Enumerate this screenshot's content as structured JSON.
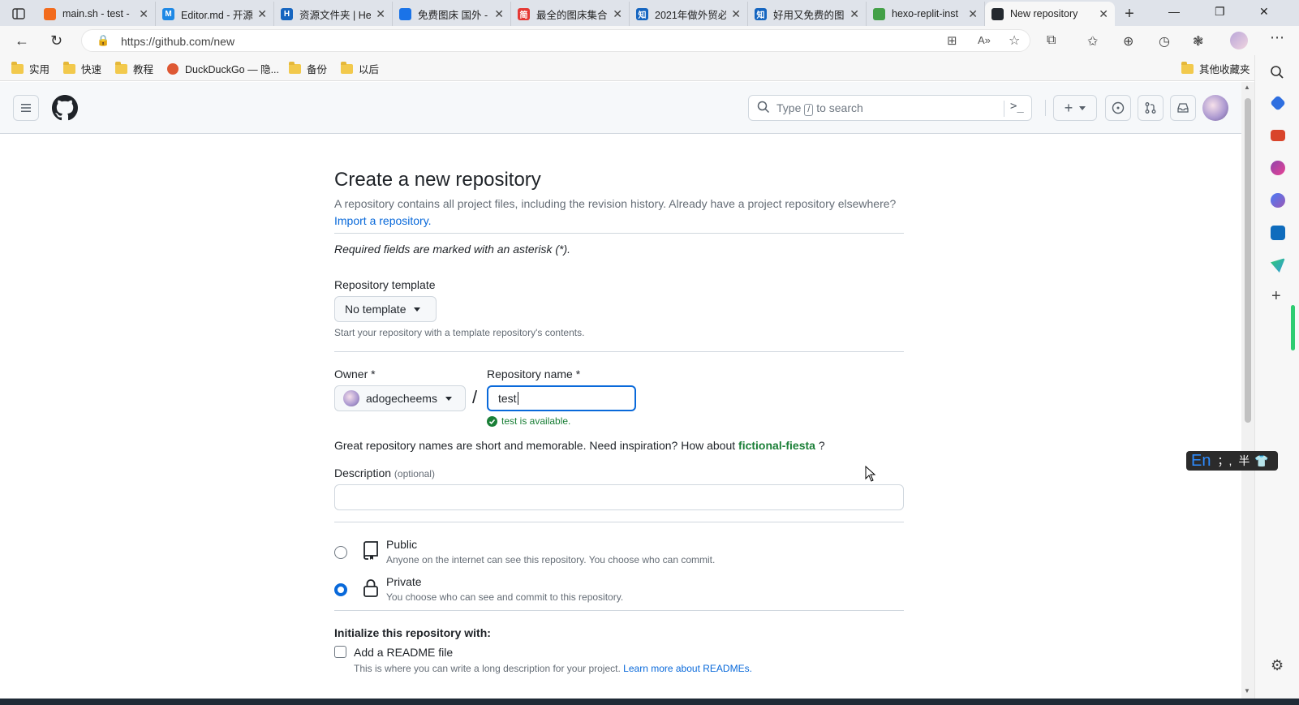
{
  "browser": {
    "tabs": [
      {
        "title": "main.sh - test -",
        "color": "#f26b1d",
        "glyph": ""
      },
      {
        "title": "Editor.md - 开源",
        "color": "#1e88e5",
        "glyph": "M"
      },
      {
        "title": "资源文件夹 | He",
        "color": "#1565c0",
        "glyph": "H"
      },
      {
        "title": "免费图床 国外 -",
        "color": "#1a73e8",
        "glyph": ""
      },
      {
        "title": "最全的图床集合",
        "color": "#e53935",
        "glyph": "简"
      },
      {
        "title": "2021年做外贸必",
        "color": "#1565c0",
        "glyph": "知"
      },
      {
        "title": "好用又免费的图",
        "color": "#1565c0",
        "glyph": "知"
      },
      {
        "title": "hexo-replit-inst",
        "color": "#43a047",
        "glyph": ""
      },
      {
        "title": "New repository",
        "color": "#24292f",
        "glyph": ""
      }
    ],
    "url": "https://github.com/new",
    "bookmarks": [
      "实用",
      "快速",
      "教程",
      "DuckDuckGo — 隐...",
      "备份",
      "以后"
    ],
    "other_bookmarks": "其他收藏夹"
  },
  "github": {
    "search_placeholder_prefix": "Type",
    "search_key": "/",
    "search_placeholder_suffix": "to search"
  },
  "form": {
    "title": "Create a new repository",
    "subtitle": "A repository contains all project files, including the revision history. Already have a project repository elsewhere?",
    "import_link": "Import a repository.",
    "required_note": "Required fields are marked with an asterisk (*).",
    "template_label": "Repository template",
    "template_value": "No template",
    "template_note": "Start your repository with a template repository's contents.",
    "owner_label": "Owner *",
    "owner_value": "adogecheems",
    "slash": "/",
    "repo_label": "Repository name *",
    "repo_value": "test",
    "available_msg": "test is available.",
    "inspiration_text": "Great repository names are short and memorable. Need inspiration? How about",
    "inspiration_name": "fictional-fiesta",
    "inspiration_end": "?",
    "description_label": "Description",
    "description_optional": "(optional)",
    "description_value": "",
    "visibility": [
      {
        "label": "Public",
        "desc": "Anyone on the internet can see this repository. You choose who can commit.",
        "checked": false
      },
      {
        "label": "Private",
        "desc": "You choose who can see and commit to this repository.",
        "checked": true
      }
    ],
    "init_label": "Initialize this repository with:",
    "readme_label": "Add a README file",
    "readme_desc": "This is where you can write a long description for your project.",
    "readme_link": "Learn more about READMEs."
  },
  "ime": {
    "text": "En",
    "punct": "；,",
    "width": "半"
  },
  "colors": {
    "link": "#0969da",
    "success": "#1a7f37",
    "accent": "#0969da"
  }
}
